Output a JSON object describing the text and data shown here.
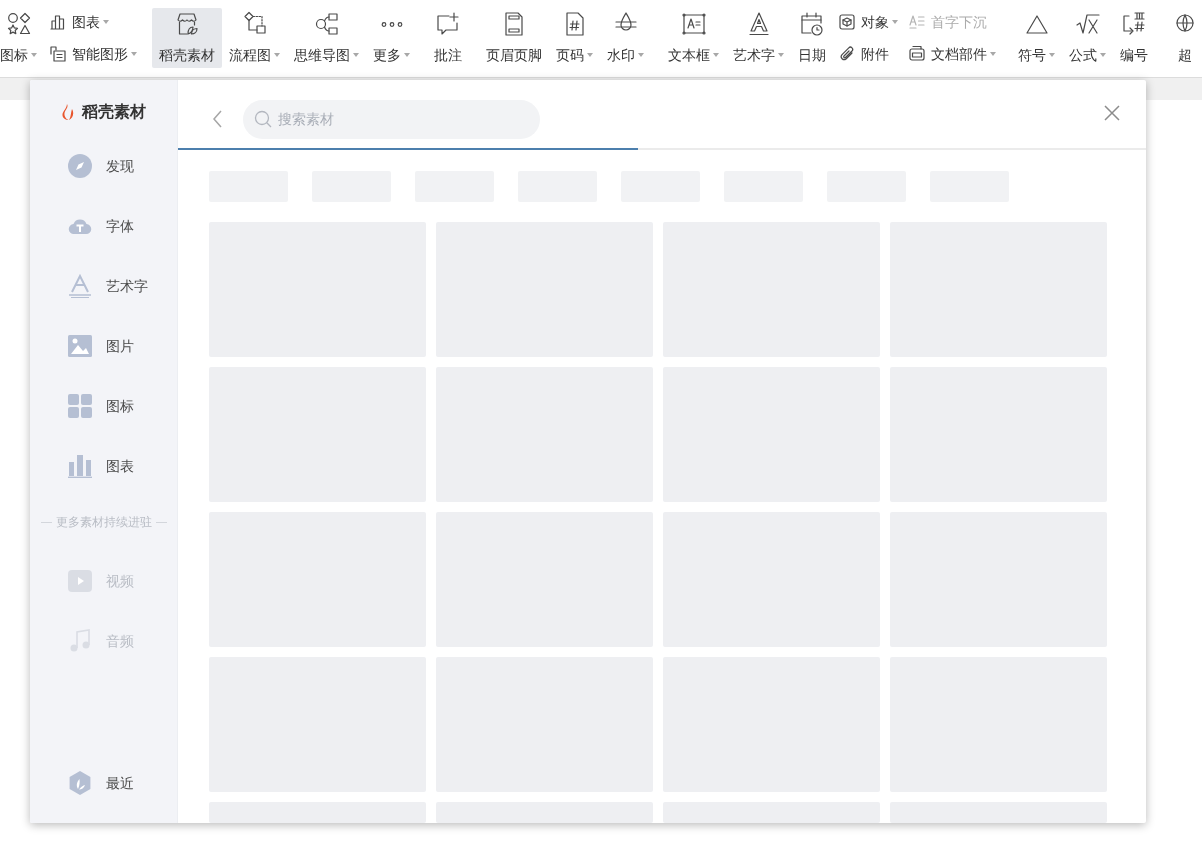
{
  "toolbar": {
    "groups": [
      {
        "items": [
          {
            "kind": "large",
            "label": "图标",
            "dropdown": true,
            "selected": false
          },
          {
            "kind": "stack",
            "rows": [
              {
                "label": "图表",
                "dropdown": true,
                "disabled": false
              },
              {
                "label": "智能图形",
                "dropdown": true,
                "disabled": false
              }
            ]
          }
        ]
      },
      {
        "items": [
          {
            "kind": "large",
            "label": "稻壳素材",
            "dropdown": false,
            "selected": true
          },
          {
            "kind": "large",
            "label": "流程图",
            "dropdown": true,
            "selected": false
          },
          {
            "kind": "large",
            "label": "思维导图",
            "dropdown": true,
            "selected": false
          },
          {
            "kind": "large",
            "label": "更多",
            "dropdown": true,
            "selected": false
          }
        ]
      },
      {
        "items": [
          {
            "kind": "large",
            "label": "批注",
            "dropdown": false,
            "selected": false
          }
        ]
      },
      {
        "items": [
          {
            "kind": "large",
            "label": "页眉页脚",
            "dropdown": false,
            "selected": false
          },
          {
            "kind": "large",
            "label": "页码",
            "dropdown": true,
            "selected": false
          },
          {
            "kind": "large",
            "label": "水印",
            "dropdown": true,
            "selected": false
          }
        ]
      },
      {
        "items": [
          {
            "kind": "large",
            "label": "文本框",
            "dropdown": true,
            "selected": false
          },
          {
            "kind": "large",
            "label": "艺术字",
            "dropdown": true,
            "selected": false
          },
          {
            "kind": "large",
            "label": "日期",
            "dropdown": false,
            "selected": false
          },
          {
            "kind": "stack",
            "rows": [
              {
                "label": "对象",
                "dropdown": true,
                "disabled": false
              },
              {
                "label": "附件",
                "dropdown": false,
                "disabled": false
              }
            ]
          },
          {
            "kind": "stack",
            "rows": [
              {
                "label": "首字下沉",
                "dropdown": false,
                "disabled": true
              },
              {
                "label": "文档部件",
                "dropdown": true,
                "disabled": false
              }
            ]
          }
        ]
      },
      {
        "items": [
          {
            "kind": "large",
            "label": "符号",
            "dropdown": true,
            "selected": false
          },
          {
            "kind": "large",
            "label": "公式",
            "dropdown": true,
            "selected": false
          },
          {
            "kind": "large",
            "label": "编号",
            "dropdown": false,
            "selected": false
          }
        ]
      },
      {
        "items": [
          {
            "kind": "large",
            "label": "超",
            "dropdown": false,
            "selected": false
          }
        ]
      }
    ]
  },
  "material_panel": {
    "sidebar": {
      "title": "稻壳素材",
      "items": [
        {
          "label": "发现",
          "disabled": false
        },
        {
          "label": "字体",
          "disabled": false
        },
        {
          "label": "艺术字",
          "disabled": false
        },
        {
          "label": "图片",
          "disabled": false
        },
        {
          "label": "图标",
          "disabled": false
        },
        {
          "label": "图表",
          "disabled": false
        }
      ],
      "divider_text": "更多素材持续进驻",
      "upcoming_items": [
        {
          "label": "视频",
          "disabled": true
        },
        {
          "label": "音频",
          "disabled": true
        }
      ],
      "recent": {
        "label": "最近"
      }
    },
    "search": {
      "placeholder": "搜索素材"
    },
    "loading_bar": {
      "level": 0.475
    }
  }
}
